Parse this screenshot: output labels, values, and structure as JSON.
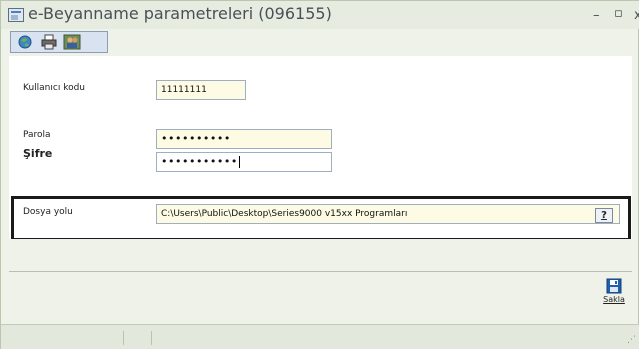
{
  "window": {
    "title": "e-Beyanname parametreleri (096155)",
    "controls": {
      "minimize": "–",
      "maximize": "▫",
      "close": "x"
    }
  },
  "toolbar": {
    "icons": [
      "globe-icon",
      "printer-icon",
      "users-icon"
    ]
  },
  "form": {
    "user_code": {
      "label": "Kullanıcı kodu",
      "value": "11111111"
    },
    "password": {
      "label": "Parola",
      "value": "••••••••••"
    },
    "cipher": {
      "label": "Şifre",
      "value": "•••••••••••"
    },
    "file_path": {
      "label": "Dosya yolu",
      "value": "C:\\Users\\Public\\Desktop\\Series9000 v15xx Programları",
      "help_label": "?"
    }
  },
  "actions": {
    "save_label": "Sakla"
  },
  "colors": {
    "window_bg": "#eef2e9",
    "field_bg": "#fdfbe3",
    "highlight_border": "#1a1a1a",
    "save_icon": "#1f5fb0"
  }
}
